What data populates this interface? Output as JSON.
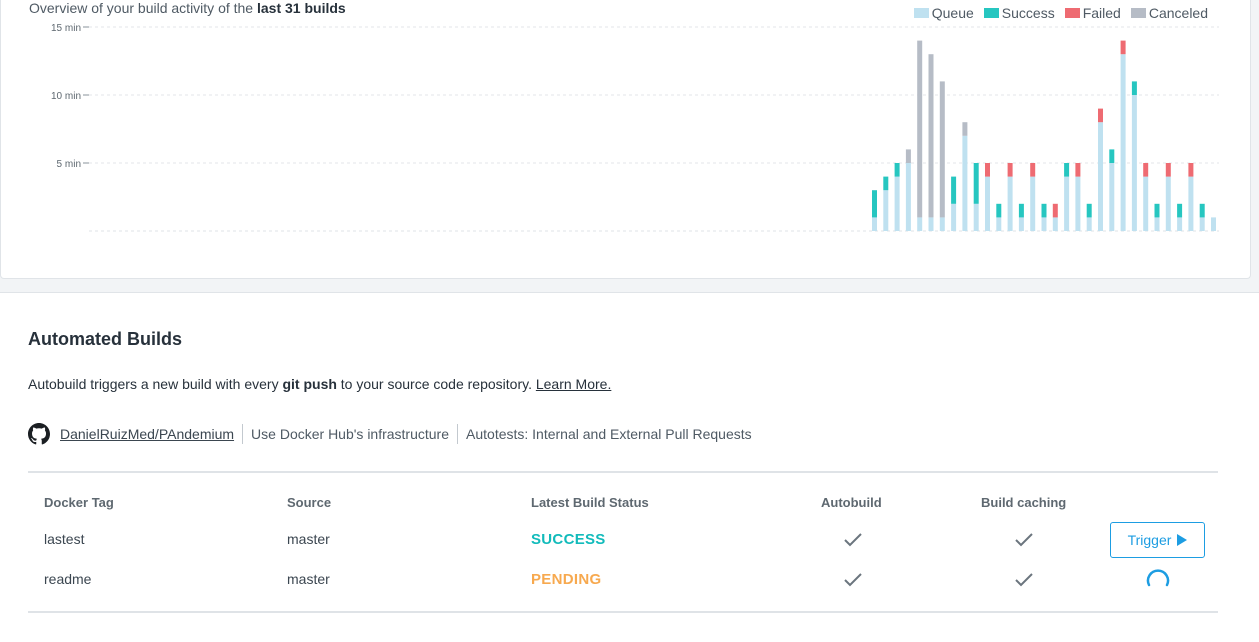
{
  "overview": {
    "prefix": "Overview of your build activity of the ",
    "bold": "last 31 builds"
  },
  "legend": [
    {
      "label": "Queue",
      "color": "#bfe1f0"
    },
    {
      "label": "Success",
      "color": "#26c6c0"
    },
    {
      "label": "Failed",
      "color": "#ee6b72"
    },
    {
      "label": "Canceled",
      "color": "#b6bcc6"
    }
  ],
  "chart_data": {
    "type": "bar",
    "stacked": true,
    "ylim": [
      0,
      15
    ],
    "yticks": [
      {
        "value": 15,
        "label": "15 min"
      },
      {
        "value": 10,
        "label": "10 min"
      },
      {
        "value": 5,
        "label": "5 min"
      }
    ],
    "grid": true,
    "legend_position": "top-right",
    "series_names": [
      "Queue",
      "Success",
      "Failed",
      "Canceled"
    ],
    "bars": [
      {
        "queue": 1,
        "success": 2,
        "failed": 0,
        "canceled": 0
      },
      {
        "queue": 3,
        "success": 1,
        "failed": 0,
        "canceled": 0
      },
      {
        "queue": 4,
        "success": 1,
        "failed": 0,
        "canceled": 0
      },
      {
        "queue": 5,
        "success": 0,
        "failed": 0,
        "canceled": 1
      },
      {
        "queue": 1,
        "success": 0,
        "failed": 0,
        "canceled": 13
      },
      {
        "queue": 1,
        "success": 0,
        "failed": 0,
        "canceled": 12
      },
      {
        "queue": 1,
        "success": 0,
        "failed": 0,
        "canceled": 10
      },
      {
        "queue": 2,
        "success": 2,
        "failed": 0,
        "canceled": 0
      },
      {
        "queue": 7,
        "success": 0,
        "failed": 0,
        "canceled": 1
      },
      {
        "queue": 2,
        "success": 3,
        "failed": 0,
        "canceled": 0
      },
      {
        "queue": 4,
        "success": 0,
        "failed": 1,
        "canceled": 0
      },
      {
        "queue": 1,
        "success": 1,
        "failed": 0,
        "canceled": 0
      },
      {
        "queue": 4,
        "success": 0,
        "failed": 1,
        "canceled": 0
      },
      {
        "queue": 1,
        "success": 1,
        "failed": 0,
        "canceled": 0
      },
      {
        "queue": 4,
        "success": 0,
        "failed": 1,
        "canceled": 0
      },
      {
        "queue": 1,
        "success": 1,
        "failed": 0,
        "canceled": 0
      },
      {
        "queue": 1,
        "success": 0,
        "failed": 1,
        "canceled": 0
      },
      {
        "queue": 4,
        "success": 1,
        "failed": 0,
        "canceled": 0
      },
      {
        "queue": 4,
        "success": 0,
        "failed": 1,
        "canceled": 0
      },
      {
        "queue": 1,
        "success": 1,
        "failed": 0,
        "canceled": 0
      },
      {
        "queue": 8,
        "success": 0,
        "failed": 1,
        "canceled": 0
      },
      {
        "queue": 5,
        "success": 1,
        "failed": 0,
        "canceled": 0
      },
      {
        "queue": 13,
        "success": 0,
        "failed": 1,
        "canceled": 0
      },
      {
        "queue": 10,
        "success": 1,
        "failed": 0,
        "canceled": 0
      },
      {
        "queue": 4,
        "success": 0,
        "failed": 1,
        "canceled": 0
      },
      {
        "queue": 1,
        "success": 1,
        "failed": 0,
        "canceled": 0
      },
      {
        "queue": 4,
        "success": 0,
        "failed": 1,
        "canceled": 0
      },
      {
        "queue": 1,
        "success": 1,
        "failed": 0,
        "canceled": 0
      },
      {
        "queue": 4,
        "success": 0,
        "failed": 1,
        "canceled": 0
      },
      {
        "queue": 1,
        "success": 1,
        "failed": 0,
        "canceled": 0
      },
      {
        "queue": 1,
        "success": 0,
        "failed": 0,
        "canceled": 0
      }
    ]
  },
  "automated": {
    "title": "Automated Builds",
    "desc_prefix": "Autobuild triggers a new build with every ",
    "desc_bold": "git push",
    "desc_suffix": " to your source code repository. ",
    "learn_more": "Learn More.",
    "repo": "DanielRuizMed/PAndemium",
    "infra": "Use Docker Hub's infrastructure",
    "autotests": "Autotests: Internal and External Pull Requests",
    "icon": "github-icon"
  },
  "table": {
    "headers": {
      "tag": "Docker Tag",
      "source": "Source",
      "status": "Latest Build Status",
      "autobuild": "Autobuild",
      "caching": "Build caching"
    },
    "rows": [
      {
        "tag": "lastest",
        "source": "master",
        "status": "SUCCESS",
        "status_color": "#12bbbb",
        "autobuild": "check-icon",
        "caching": "check-icon",
        "action": "Trigger"
      },
      {
        "tag": "readme",
        "source": "master",
        "status": "PENDING",
        "status_color": "#f7a94f",
        "autobuild": "check-icon",
        "caching": "check-icon",
        "action": "spinner-icon"
      }
    ]
  }
}
